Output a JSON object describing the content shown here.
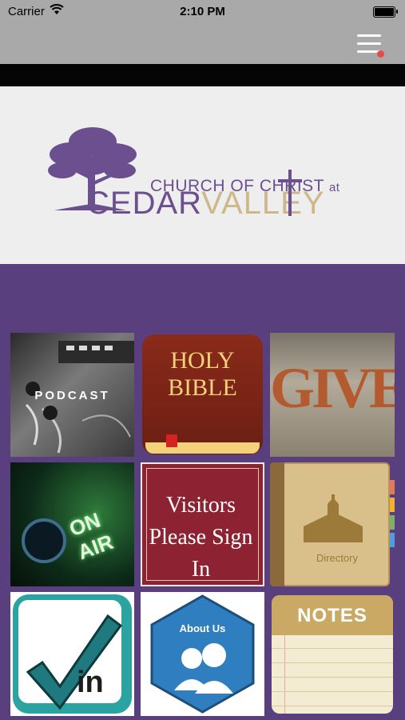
{
  "status_bar": {
    "carrier": "Carrier",
    "time": "2:10 PM"
  },
  "nav": {
    "menu_icon": "hamburger-menu-icon",
    "notification_color": "#e84a4a"
  },
  "banner": {
    "logo_line1": "CHURCH OF CHRIST",
    "logo_at": "at",
    "logo_cedar": "CEDAR",
    "logo_valley": "VALLEY",
    "accent_color": "#6b4f8f",
    "secondary_color": "#cdb889"
  },
  "theme": {
    "background": "#5a3f7e"
  },
  "tiles": {
    "podcast": {
      "label": "PODCAST"
    },
    "bible": {
      "line1": "HOLY",
      "line2": "BIBLE"
    },
    "give": {
      "label": "GIVE"
    },
    "on_air": {
      "label": "ON AIR"
    },
    "visitors": {
      "line1": "Visitors",
      "line2": "Please Sign In"
    },
    "directory": {
      "label": "Directory"
    },
    "check_in": {
      "label": "in"
    },
    "about": {
      "label": "About Us"
    },
    "notes": {
      "label": "NOTES"
    }
  }
}
